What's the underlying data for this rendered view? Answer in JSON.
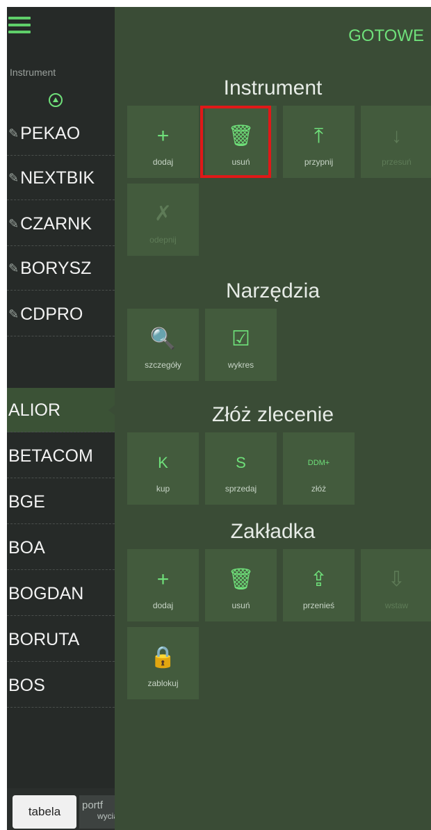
{
  "left": {
    "header_label": "Instrument",
    "rows": [
      {
        "label": "PEKAO",
        "pinned": true
      },
      {
        "label": "NEXTBIK",
        "pinned": true
      },
      {
        "label": "CZARNK",
        "pinned": true
      },
      {
        "label": "BORYSZ",
        "pinned": true
      },
      {
        "label": "CDPRO",
        "pinned": true
      },
      {
        "label": "ALIOR",
        "pinned": false,
        "active": true
      },
      {
        "label": "BETACOM",
        "pinned": false
      },
      {
        "label": "BGE",
        "pinned": false
      },
      {
        "label": "BOA",
        "pinned": false
      },
      {
        "label": "BOGDAN",
        "pinned": false
      },
      {
        "label": "BORUTA",
        "pinned": false
      },
      {
        "label": "BOS",
        "pinned": false
      }
    ],
    "tabs": {
      "tabela": "tabela",
      "portfolio": "portf",
      "portfolio_sub": "wycia"
    }
  },
  "panel": {
    "done_label": "GOTOWE",
    "sections": [
      {
        "title": "Instrument",
        "tiles": [
          {
            "label": "dodaj",
            "icon": "plus-icon",
            "glyph": "+",
            "disabled": false
          },
          {
            "label": "usuń",
            "icon": "trash-icon",
            "glyph": "🗑",
            "disabled": false
          },
          {
            "label": "przypnij",
            "icon": "pin-top-icon",
            "glyph": "⤒",
            "disabled": false
          },
          {
            "label": "przesuń",
            "icon": "move-down-icon",
            "glyph": "↓",
            "disabled": true
          },
          {
            "label": "odepnij",
            "icon": "unpin-icon",
            "glyph": "✗",
            "disabled": true
          }
        ]
      },
      {
        "title": "Narzędzia",
        "tiles": [
          {
            "label": "szczegóły",
            "icon": "magnifier-icon",
            "glyph": "🔍",
            "disabled": false
          },
          {
            "label": "wykres",
            "icon": "chart-icon",
            "glyph": "☑",
            "disabled": false
          }
        ]
      },
      {
        "title": "Złóż zlecenie",
        "tiles": [
          {
            "label": "kup",
            "icon": "buy-letter-icon",
            "glyph": "K",
            "disabled": false
          },
          {
            "label": "sprzedaj",
            "icon": "sell-letter-icon",
            "glyph": "S",
            "disabled": false
          },
          {
            "label": "złóż",
            "icon": "ddm-icon",
            "glyph": "DDM+",
            "disabled": false
          }
        ]
      },
      {
        "title": "Zakładka",
        "tiles": [
          {
            "label": "dodaj",
            "icon": "plus-icon",
            "glyph": "+",
            "disabled": false
          },
          {
            "label": "usuń",
            "icon": "trash-icon",
            "glyph": "🗑",
            "disabled": false
          },
          {
            "label": "przenieś",
            "icon": "upload-icon",
            "glyph": "⇪",
            "disabled": false
          },
          {
            "label": "wstaw",
            "icon": "download-icon",
            "glyph": "⇩",
            "disabled": true
          },
          {
            "label": "zablokuj",
            "icon": "lock-icon",
            "glyph": "🔒",
            "disabled": false
          }
        ]
      }
    ]
  },
  "colors": {
    "accent": "#6fe07a",
    "panel_bg": "#3a4c36",
    "tile_bg": "#435b3d",
    "highlight": "#e01818"
  }
}
